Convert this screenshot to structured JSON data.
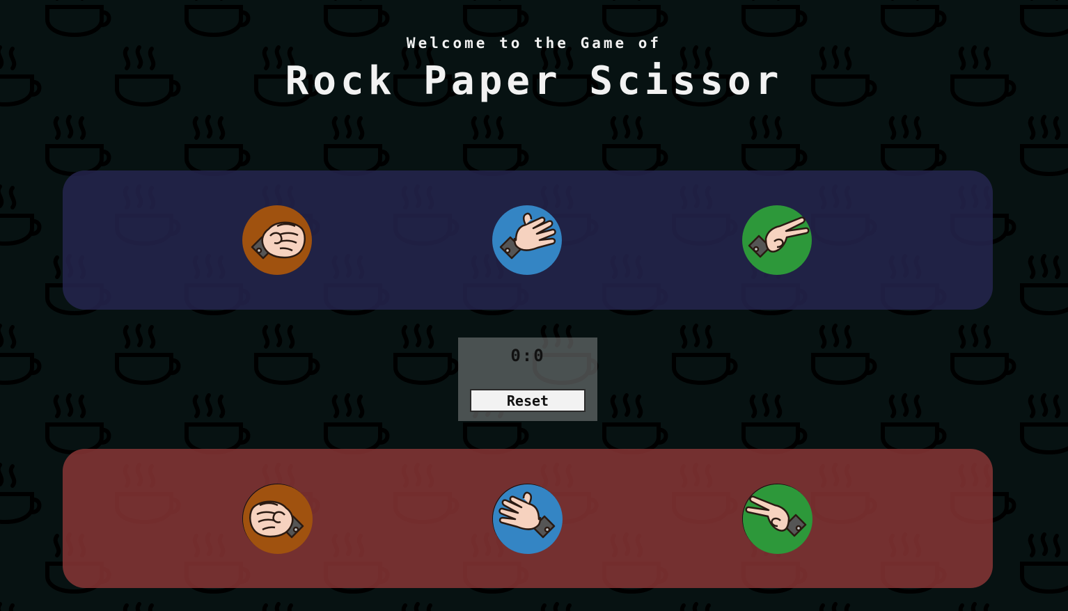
{
  "header": {
    "subtitle": "Welcome to the Game of",
    "title": "Rock Paper Scissor"
  },
  "player_panel": {
    "color": "#262650",
    "choices": [
      {
        "icon": "rock-fist-icon",
        "color": "#a0520f"
      },
      {
        "icon": "paper-hand-icon",
        "color": "#3485c4"
      },
      {
        "icon": "scissors-hand-icon",
        "color": "#2d983a"
      }
    ]
  },
  "computer_panel": {
    "color": "#8c3737",
    "choices": [
      {
        "icon": "rock-fist-icon",
        "color": "#a0520f"
      },
      {
        "icon": "paper-hand-icon",
        "color": "#3485c4"
      },
      {
        "icon": "scissors-hand-icon",
        "color": "#2d983a"
      }
    ]
  },
  "scoreboard": {
    "score": "0:0",
    "reset_label": "Reset"
  },
  "background": {
    "color": "#071212",
    "pattern_icon": "coffee-cup-icon"
  }
}
